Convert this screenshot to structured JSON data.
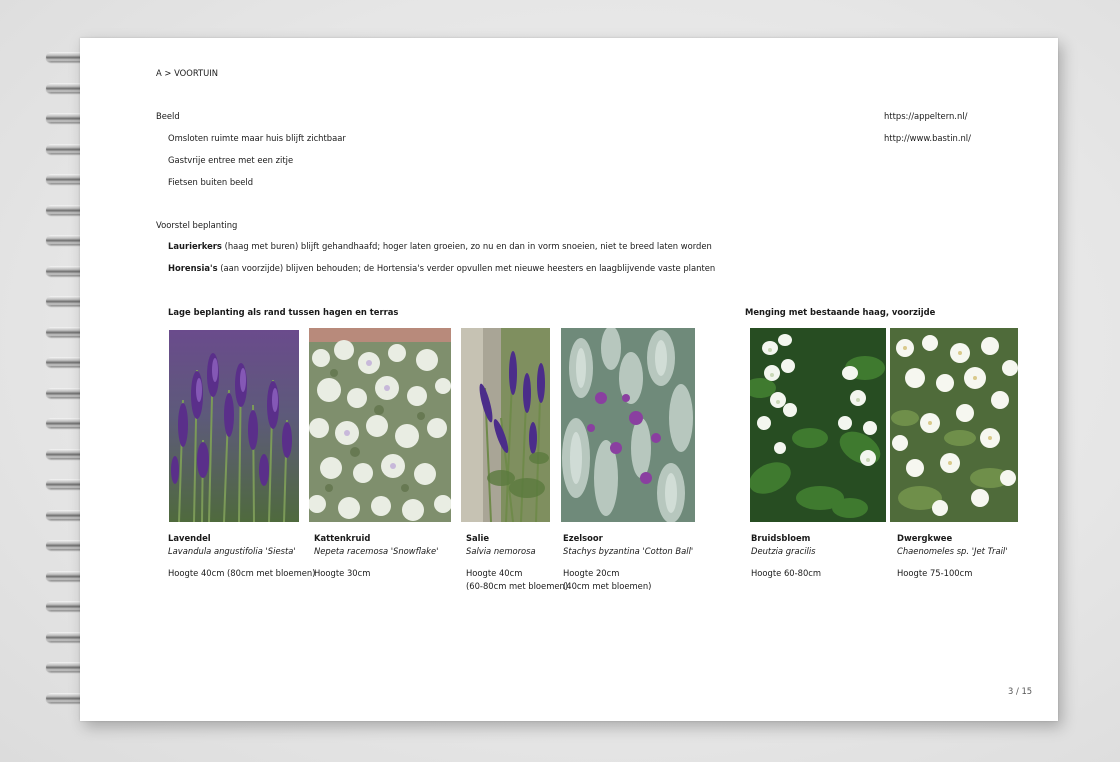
{
  "breadcrumb": "A > VOORTUIN",
  "beeld": {
    "heading": "Beeld",
    "items": [
      "Omsloten ruimte maar huis blijft zichtbaar",
      "Gastvrije entree met een zitje",
      "Fietsen buiten beeld"
    ]
  },
  "links": [
    "https://appeltern.nl/",
    "http://www.bastin.nl/"
  ],
  "voorstel": {
    "heading": "Voorstel beplanting",
    "lines": [
      {
        "bold": "Laurierkers",
        "rest": " (haag met buren) blijft gehandhaafd; hoger laten groeien, zo nu en dan in vorm snoeien, niet te breed laten worden"
      },
      {
        "bold": "Horensia's",
        "rest": " (aan voorzijde) blijven behouden; de Hortensia's verder opvullen met nieuwe heesters en laagblijvende vaste planten"
      }
    ]
  },
  "sections": {
    "left": "Lage beplanting als rand tussen hagen en terras",
    "right": "Menging met bestaande haag, voorzijde"
  },
  "plants": [
    {
      "name": "Lavendel",
      "latin": "Lavandula angustifolia 'Siesta'",
      "height": [
        "Hoogte 40cm (80cm met bloemen)"
      ]
    },
    {
      "name": "Kattenkruid",
      "latin": "Nepeta racemosa 'Snowflake'",
      "height": [
        "Hoogte 30cm"
      ]
    },
    {
      "name": "Salie",
      "latin": "Salvia nemorosa",
      "height": [
        "Hoogte 40cm",
        "(60-80cm met bloemen)"
      ]
    },
    {
      "name": "Ezelsoor",
      "latin": "Stachys byzantina 'Cotton Ball'",
      "height": [
        "Hoogte 20cm",
        "(40cm met bloemen)"
      ]
    },
    {
      "name": "Bruidsbloem",
      "latin": "Deutzia gracilis",
      "height": [
        "Hoogte 60-80cm"
      ]
    },
    {
      "name": "Dwergkwee",
      "latin": "Chaenomeles sp. 'Jet Trail'",
      "height": [
        "Hoogte 75-100cm"
      ]
    }
  ],
  "page_number": "3 / 15"
}
